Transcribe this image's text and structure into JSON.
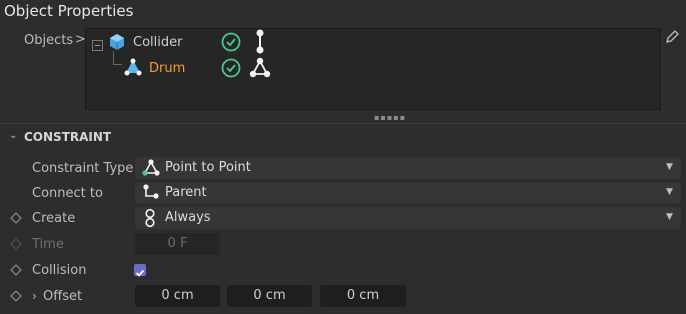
{
  "panel": {
    "title": "Object Properties"
  },
  "objects": {
    "label": "Objects",
    "arrow": ">",
    "tree": [
      {
        "name": "Collider",
        "enabled": true,
        "icon": "cube-icon",
        "tag_icon": "connector-icon"
      },
      {
        "name": "Drum",
        "enabled": true,
        "icon": "constraint-object-icon",
        "tag_icon": "point-to-point-icon",
        "color": "#f0a030"
      }
    ]
  },
  "section": {
    "title": "CONSTRAINT"
  },
  "props": {
    "constraint_type": {
      "label": "Constraint Type",
      "value": "Point to Point"
    },
    "connect_to": {
      "label": "Connect to",
      "value": "Parent"
    },
    "create": {
      "label": "Create",
      "value": "Always"
    },
    "time": {
      "label": "Time",
      "value": "0 F"
    },
    "collision": {
      "label": "Collision",
      "checked": true
    },
    "offset": {
      "label": "Offset",
      "values": [
        "0 cm",
        "0 cm",
        "0 cm"
      ]
    }
  },
  "colors": {
    "accent": "#6b6cc7",
    "check_green": "#4cc88a",
    "highlight": "#f0a030"
  }
}
